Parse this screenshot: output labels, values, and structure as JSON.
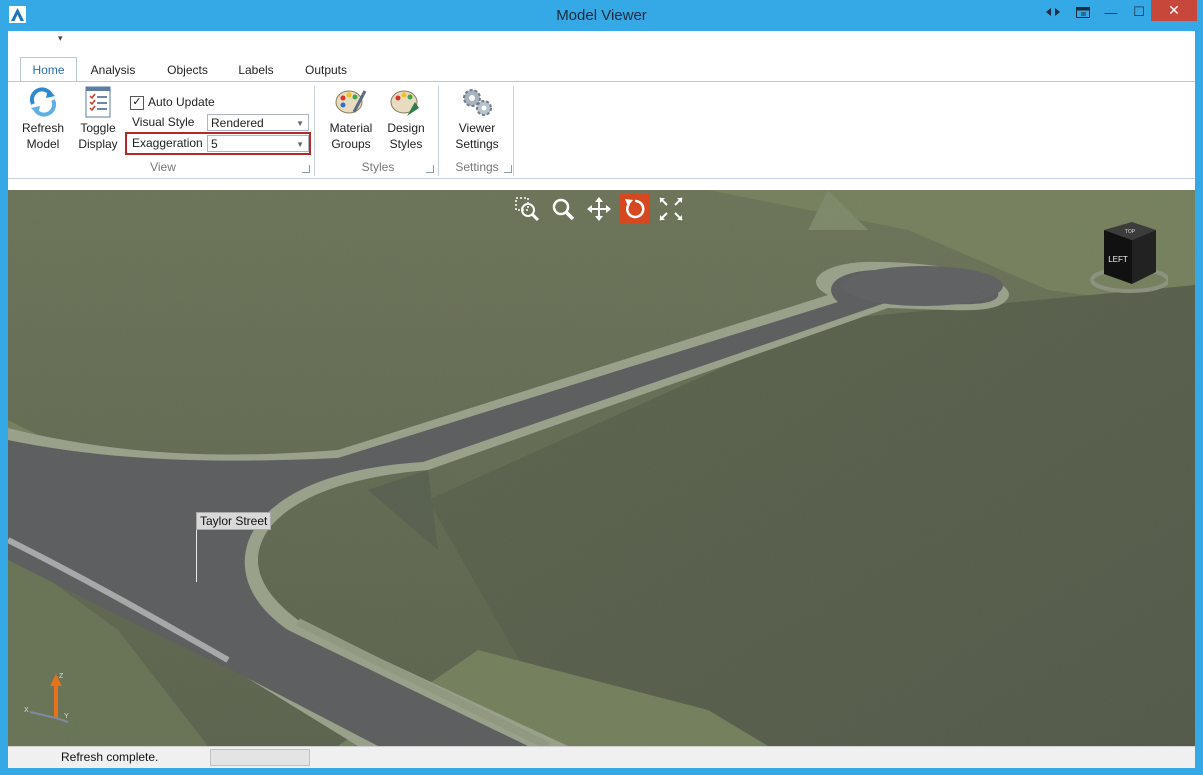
{
  "window": {
    "title": "Model Viewer",
    "controls": {
      "minimize": "—",
      "maximize": "☐",
      "close": "✕"
    }
  },
  "qat": {
    "dropdown": "▾"
  },
  "tabs": [
    {
      "label": "Home",
      "active": true
    },
    {
      "label": "Analysis",
      "active": false
    },
    {
      "label": "Objects",
      "active": false
    },
    {
      "label": "Labels",
      "active": false
    },
    {
      "label": "Outputs",
      "active": false
    }
  ],
  "ribbon": {
    "view_group": {
      "label": "View",
      "refresh": {
        "line1": "Refresh",
        "line2": "Model"
      },
      "toggle": {
        "line1": "Toggle",
        "line2": "Display"
      },
      "auto_update": {
        "label": "Auto Update",
        "checked": true,
        "check_glyph": "✓"
      },
      "visual_style": {
        "label": "Visual Style",
        "value": "Rendered"
      },
      "exaggeration": {
        "label": "Exaggeration",
        "value": "5"
      }
    },
    "styles_group": {
      "label": "Styles",
      "material": {
        "line1": "Material",
        "line2": "Groups"
      },
      "design": {
        "line1": "Design",
        "line2": "Styles"
      }
    },
    "settings_group": {
      "label": "Settings",
      "viewer": {
        "line1": "Viewer",
        "line2": "Settings"
      }
    }
  },
  "viewport": {
    "street_label": "Taylor Street",
    "viewcube": {
      "face_left": "LEFT",
      "face_top": "TOP"
    },
    "axis": {
      "z": "Z",
      "x": "X",
      "y": "Y"
    },
    "nav_tools": [
      "zoom-extents",
      "zoom",
      "pan",
      "orbit",
      "fullscreen"
    ],
    "active_tool": "orbit",
    "accent_color": "#d6481f"
  },
  "status": {
    "text": "Refresh complete.",
    "progress": 0
  }
}
